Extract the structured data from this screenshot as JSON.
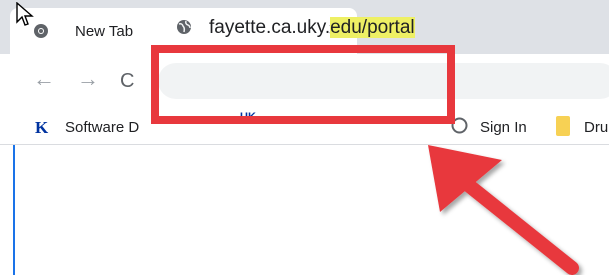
{
  "tab": {
    "title": "New Tab",
    "close_symbol": "×",
    "new_tab_symbol": "+",
    "icon": "chrome-icon"
  },
  "toolbar": {
    "back_symbol": "←",
    "forward_symbol": "→",
    "reload_symbol": "C",
    "url_plain": "fayette.ca.uky.",
    "url_highlight": "edu/portal",
    "site_icon": "globe-icon"
  },
  "bookmarks": {
    "items": [
      {
        "label": "Software D",
        "icon": "uk-logo-icon"
      },
      {
        "label": "UK",
        "icon": "uk-logo-icon"
      },
      {
        "label": "Sign In",
        "icon": "signin-icon"
      },
      {
        "label": "Dru",
        "icon": "folder-icon"
      }
    ]
  },
  "annotation": {
    "box_color": "#e8383d",
    "arrow_color": "#e8383d",
    "highlight_color": "#eef064"
  }
}
